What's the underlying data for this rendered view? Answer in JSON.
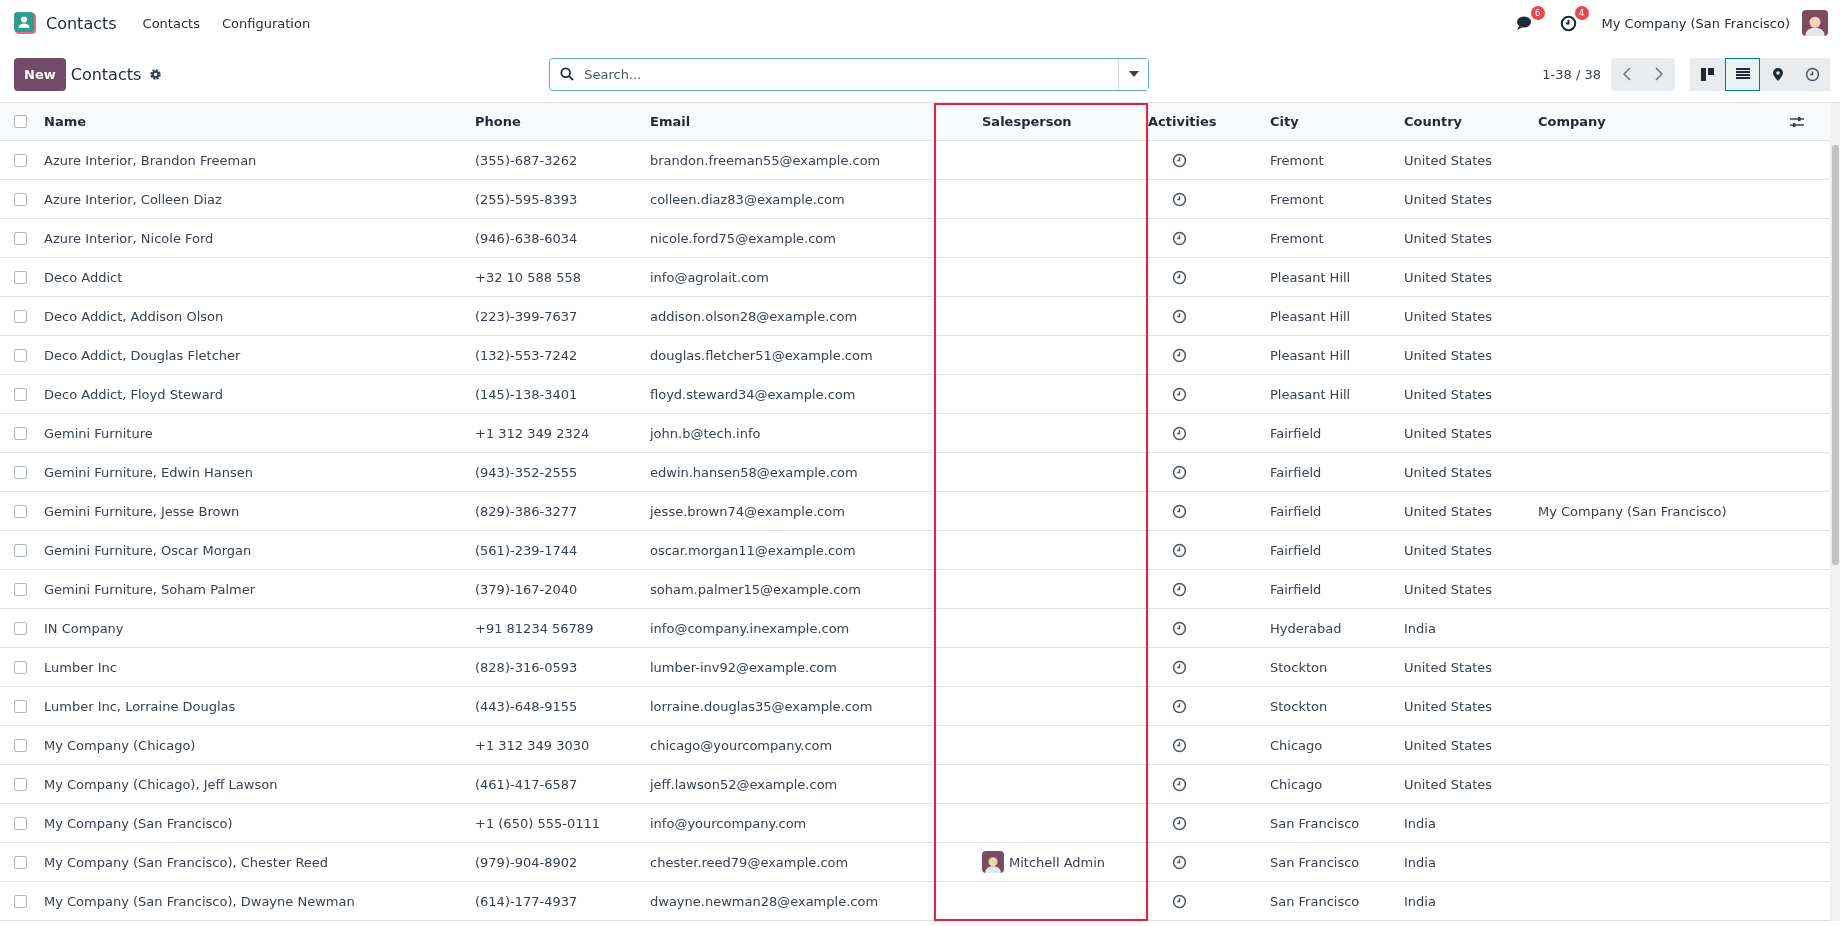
{
  "navbar": {
    "app_name": "Contacts",
    "menus": [
      "Contacts",
      "Configuration"
    ],
    "messages_badge": "6",
    "activities_badge": "4",
    "company": "My Company (San Francisco)"
  },
  "control_panel": {
    "new_button": "New",
    "title": "Contacts",
    "search": {
      "placeholder": "Search..."
    },
    "pager": "1-38 / 38",
    "views": [
      {
        "kind": "kanban",
        "selected": false
      },
      {
        "kind": "list",
        "selected": true
      },
      {
        "kind": "map",
        "selected": false
      },
      {
        "kind": "activity",
        "selected": false
      }
    ]
  },
  "table": {
    "all_checked": false,
    "columns": [
      {
        "label": "Name",
        "highlighted": false
      },
      {
        "label": "Phone",
        "highlighted": false
      },
      {
        "label": "Email",
        "highlighted": false
      },
      {
        "label": "Salesperson",
        "highlighted": true
      },
      {
        "label": "Activities",
        "highlighted": false
      },
      {
        "label": "City",
        "highlighted": false
      },
      {
        "label": "Country",
        "highlighted": false
      },
      {
        "label": "Company",
        "highlighted": false
      }
    ],
    "rows": [
      {
        "checked": false,
        "name": "Azure Interior, Brandon Freeman",
        "phone": "(355)-687-3262",
        "email": "brandon.freeman55@example.com",
        "city": "Fremont",
        "country": "United States"
      },
      {
        "checked": false,
        "name": "Azure Interior, Colleen Diaz",
        "phone": "(255)-595-8393",
        "email": "colleen.diaz83@example.com",
        "city": "Fremont",
        "country": "United States"
      },
      {
        "checked": false,
        "name": "Azure Interior, Nicole Ford",
        "phone": "(946)-638-6034",
        "email": "nicole.ford75@example.com",
        "city": "Fremont",
        "country": "United States"
      },
      {
        "checked": false,
        "name": "Deco Addict",
        "phone": "+32 10 588 558",
        "email": "info@agrolait.com",
        "city": "Pleasant Hill",
        "country": "United States"
      },
      {
        "checked": false,
        "name": "Deco Addict, Addison Olson",
        "phone": "(223)-399-7637",
        "email": "addison.olson28@example.com",
        "city": "Pleasant Hill",
        "country": "United States"
      },
      {
        "checked": false,
        "name": "Deco Addict, Douglas Fletcher",
        "phone": "(132)-553-7242",
        "email": "douglas.fletcher51@example.com",
        "city": "Pleasant Hill",
        "country": "United States"
      },
      {
        "checked": false,
        "name": "Deco Addict, Floyd Steward",
        "phone": "(145)-138-3401",
        "email": "floyd.steward34@example.com",
        "city": "Pleasant Hill",
        "country": "United States"
      },
      {
        "checked": false,
        "name": "Gemini Furniture",
        "phone": "+1 312 349 2324",
        "email": "john.b@tech.info",
        "city": "Fairfield",
        "country": "United States"
      },
      {
        "checked": false,
        "name": "Gemini Furniture, Edwin Hansen",
        "phone": "(943)-352-2555",
        "email": "edwin.hansen58@example.com",
        "city": "Fairfield",
        "country": "United States"
      },
      {
        "checked": false,
        "name": "Gemini Furniture, Jesse Brown",
        "phone": "(829)-386-3277",
        "email": "jesse.brown74@example.com",
        "city": "Fairfield",
        "country": "United States",
        "company": "My Company (San Francisco)"
      },
      {
        "checked": false,
        "name": "Gemini Furniture, Oscar Morgan",
        "phone": "(561)-239-1744",
        "email": "oscar.morgan11@example.com",
        "city": "Fairfield",
        "country": "United States"
      },
      {
        "checked": false,
        "name": "Gemini Furniture, Soham Palmer",
        "phone": "(379)-167-2040",
        "email": "soham.palmer15@example.com",
        "city": "Fairfield",
        "country": "United States"
      },
      {
        "checked": false,
        "name": "IN Company",
        "phone": "+91 81234 56789",
        "email": "info@company.inexample.com",
        "city": "Hyderabad",
        "country": "India"
      },
      {
        "checked": false,
        "name": "Lumber Inc",
        "phone": "(828)-316-0593",
        "email": "lumber-inv92@example.com",
        "city": "Stockton",
        "country": "United States"
      },
      {
        "checked": false,
        "name": "Lumber Inc, Lorraine Douglas",
        "phone": "(443)-648-9155",
        "email": "lorraine.douglas35@example.com",
        "city": "Stockton",
        "country": "United States"
      },
      {
        "checked": false,
        "name": "My Company (Chicago)",
        "phone": "+1 312 349 3030",
        "email": "chicago@yourcompany.com",
        "city": "Chicago",
        "country": "United States"
      },
      {
        "checked": false,
        "name": "My Company (Chicago), Jeff Lawson",
        "phone": "(461)-417-6587",
        "email": "jeff.lawson52@example.com",
        "city": "Chicago",
        "country": "United States"
      },
      {
        "checked": false,
        "name": "My Company (San Francisco)",
        "phone": "+1 (650) 555-0111",
        "email": "info@yourcompany.com",
        "city": "San Francisco",
        "country": "India"
      },
      {
        "checked": false,
        "name": "My Company (San Francisco), Chester Reed",
        "phone": "(979)-904-8902",
        "email": "chester.reed79@example.com",
        "salesperson": "Mitchell Admin",
        "city": "San Francisco",
        "country": "India"
      },
      {
        "checked": false,
        "name": "My Company (San Francisco), Dwayne Newman",
        "phone": "(614)-177-4937",
        "email": "dwayne.newman28@example.com",
        "city": "San Francisco",
        "country": "India"
      }
    ]
  }
}
